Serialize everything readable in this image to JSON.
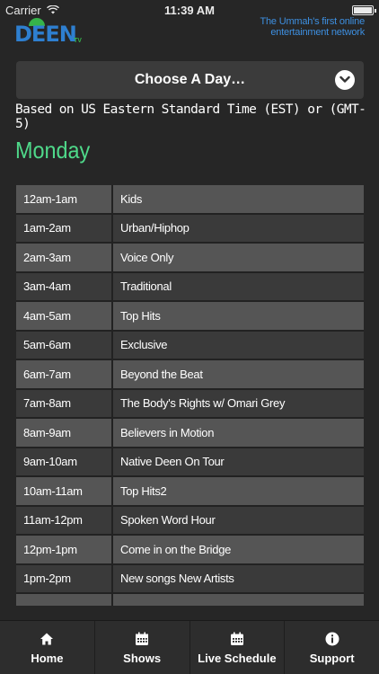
{
  "status_bar": {
    "carrier": "Carrier",
    "time": "11:39 AM"
  },
  "header": {
    "logo_text": "DEEN",
    "logo_sub": "TV",
    "tagline_line1": "The Ummah's first online",
    "tagline_line2": "entertainment network"
  },
  "day_select": {
    "label": "Choose A Day…",
    "icon": "chevron-down-icon"
  },
  "timezone_note": "Based on US Eastern Standard Time (EST) or (GMT-5)",
  "day_title": "Monday",
  "schedule": [
    {
      "time": "12am-1am",
      "show": "Kids"
    },
    {
      "time": "1am-2am",
      "show": "Urban/Hiphop"
    },
    {
      "time": "2am-3am",
      "show": "Voice Only"
    },
    {
      "time": "3am-4am",
      "show": "Traditional"
    },
    {
      "time": "4am-5am",
      "show": "Top Hits"
    },
    {
      "time": "5am-6am",
      "show": "Exclusive"
    },
    {
      "time": "6am-7am",
      "show": "Beyond the Beat"
    },
    {
      "time": "7am-8am",
      "show": "The Body's Rights w/ Omari Grey"
    },
    {
      "time": "8am-9am",
      "show": "Believers in Motion"
    },
    {
      "time": "9am-10am",
      "show": "Native Deen On Tour"
    },
    {
      "time": "10am-11am",
      "show": "Top Hits2"
    },
    {
      "time": "11am-12pm",
      "show": "Spoken Word Hour"
    },
    {
      "time": "12pm-1pm",
      "show": "Come in on the Bridge"
    },
    {
      "time": "1pm-2pm",
      "show": "New songs New Artists"
    }
  ],
  "tabs": [
    {
      "label": "Home",
      "icon": "home-icon"
    },
    {
      "label": "Shows",
      "icon": "calendar-icon"
    },
    {
      "label": "Live Schedule",
      "icon": "calendar-icon"
    },
    {
      "label": "Support",
      "icon": "info-icon"
    }
  ],
  "colors": {
    "background": "#262626",
    "accent_green": "#4fd98a",
    "logo_blue": "#2e7fd0",
    "tagline_blue": "#3d8fe0",
    "row_light": "#555555",
    "row_dark": "#3a3a3a"
  }
}
